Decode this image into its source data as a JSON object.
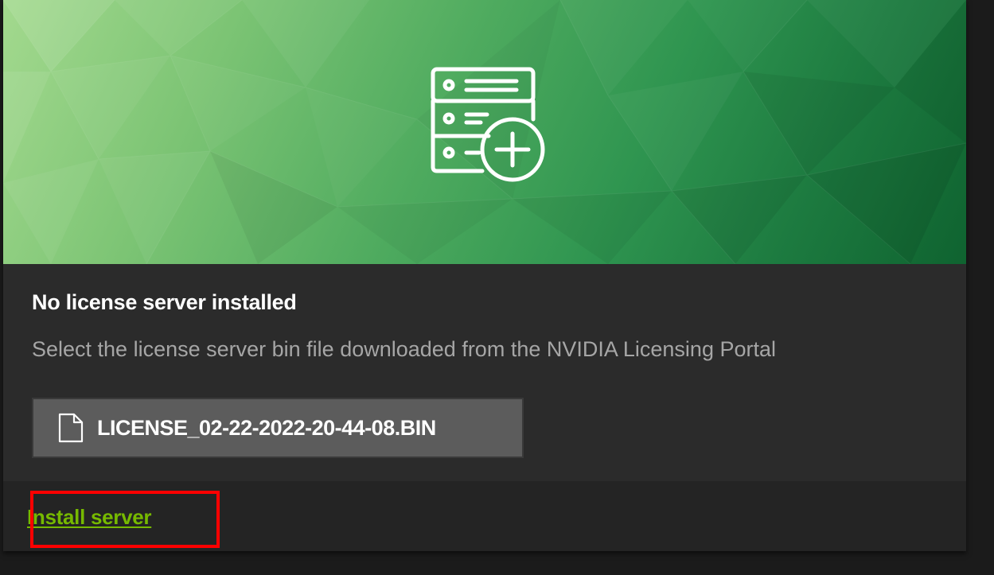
{
  "hero": {
    "icon": "server-add-icon"
  },
  "content": {
    "title": "No license server installed",
    "description": "Select the license server bin file downloaded from the NVIDIA Licensing Portal",
    "file": {
      "icon": "file-icon",
      "name": "LICENSE_02-22-2022-20-44-08.BIN"
    }
  },
  "footer": {
    "install_label": "Install server"
  },
  "colors": {
    "accent": "#76b900",
    "highlight": "#ff0000",
    "card_bg": "#2b2b2b",
    "page_bg": "#1b1b1b"
  }
}
